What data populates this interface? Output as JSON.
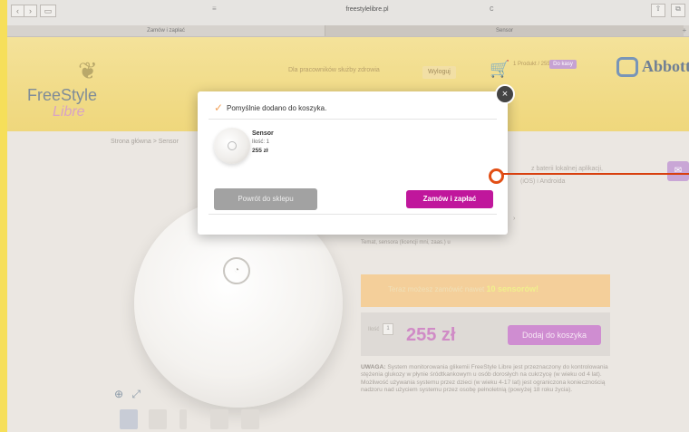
{
  "browser": {
    "url": "freestylelibre.pl",
    "tabs": [
      "Zamów i zapłać",
      "Sensor"
    ],
    "nav_back": "‹",
    "nav_forward": "›",
    "reload": "c"
  },
  "header": {
    "logo_free": "FreeStyle",
    "logo_libre": "Libre",
    "link_professionals": "Dla pracowników służby zdrowia",
    "link_logout": "Wyloguj",
    "cart_text": "1 Produkt / 255 zł",
    "cart_badge": "Do kasy",
    "brand": "Abbott"
  },
  "page": {
    "breadcrumb": "Strona główna > Sensor",
    "side_text_1": "z baterii lokalnej aplikacji,",
    "side_text_2": "(iOS) i Androida",
    "side_text_3": "Temat, sensora (licencji mni, zaas.) u",
    "promo_text": "Teraz możesz zamówić nawet ",
    "promo_strong": "10 sensorów!",
    "qty_label": "Ilość",
    "qty_value": "1",
    "price": "255 zł",
    "add_to_cart": "Dodaj do koszyka",
    "notice_title": "UWAGA:",
    "notice_body": " System monitorowania glikemii FreeStyle Libre jest przeznaczony do kontrolowania stężenia glukozy w płynie śródtkankowym u osób dorosłych na cukrzycę (w wieku od 4 lat). Możliwość używania systemu przez dzieci (w wieku 4-17 lat) jest ograniczona koniecznością nadzoru nad użyciem systemu przez osobę pełnoletnią (powyżej 18 roku życia)."
  },
  "modal": {
    "title": "Pomyślnie dodano do koszyka.",
    "product_name": "Sensor",
    "product_qty": "Ilość: 1",
    "product_price": "255 zł",
    "back_button": "Powrót do sklepu",
    "order_button": "Zamów i zapłać",
    "close": "×"
  },
  "colors": {
    "order_button": "#c0179c",
    "callout": "#e24f15",
    "page_border": "#f6df5a"
  }
}
